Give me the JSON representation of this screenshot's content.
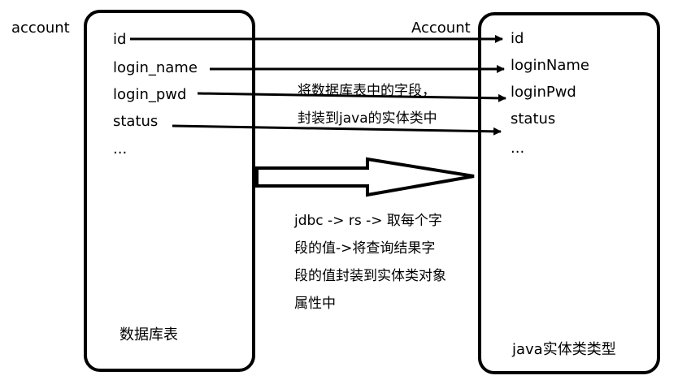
{
  "left_table": {
    "title": "account",
    "fields": [
      "id",
      "login_name",
      "login_pwd",
      "status",
      "..."
    ],
    "footer": "数据库表"
  },
  "right_class": {
    "title": "Account",
    "fields": [
      "id",
      "loginName",
      "loginPwd",
      "status",
      "..."
    ],
    "footer": "java实体类类型"
  },
  "notes": {
    "mapping": "将数据库表中的字段，封装到java的实体类中",
    "process": "jdbc -> rs -> 取每个字段的值->将查询结果字段的值封装到实体类对象属性中"
  }
}
